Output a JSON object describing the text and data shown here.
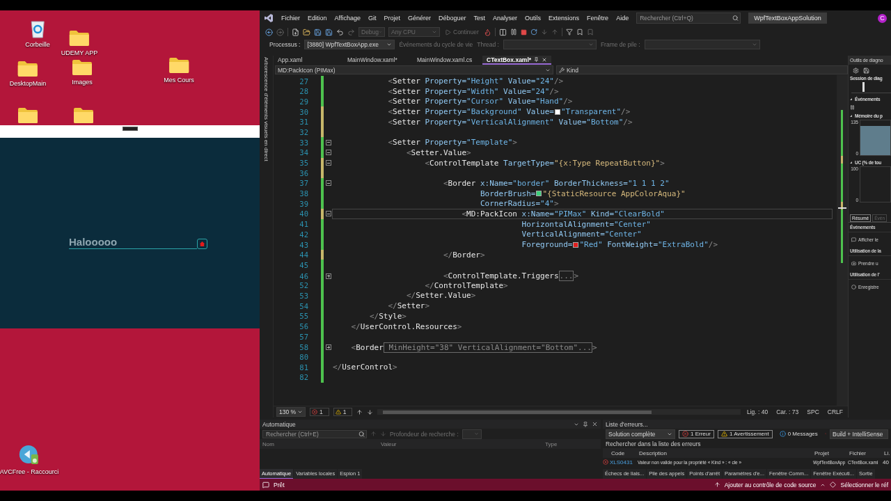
{
  "desktop": {
    "icons": [
      {
        "kind": "recycle-bin",
        "label": "Corbeille"
      },
      {
        "kind": "folder",
        "label": "UDEMY APP"
      },
      {
        "kind": "folder",
        "label": "DesktopMain"
      },
      {
        "kind": "folder",
        "label": "Images"
      },
      {
        "kind": "folder",
        "label": "Mes Cours"
      },
      {
        "kind": "folder"
      },
      {
        "kind": "folder"
      },
      {
        "kind": "app",
        "label": "AVCFree - Raccourci"
      }
    ],
    "preview_window": {
      "text_field": {
        "value": "Halooooo"
      }
    }
  },
  "ide": {
    "menu": [
      "Fichier",
      "Edition",
      "Affichage",
      "Git",
      "Projet",
      "Générer",
      "Déboguer",
      "Test",
      "Analyser",
      "Outils",
      "Extensions",
      "Fenêtre",
      "Aide"
    ],
    "search": {
      "placeholder": "Rechercher (Ctrl+Q)"
    },
    "solution": "WpfTextBoxAppSolution",
    "avatar": "C",
    "toolbar": {
      "configuration": {
        "value": "Debug",
        "disabled": true
      },
      "platform": {
        "value": "Any CPU",
        "disabled": true
      },
      "continue": {
        "label": "Continuer",
        "disabled": true
      }
    },
    "process_bar": {
      "process_label": "Processus :",
      "process": "[3880] WpfTextBoxApp.exe",
      "lifecycle": "Événements du cycle de vie",
      "thread_label": "Thread :",
      "frame_label": "Frame de pile :"
    },
    "side_strip": "Arborescence d'éléments visuels en direct",
    "tabs": [
      {
        "label": "App.xaml",
        "selected": false
      },
      {
        "label": "MainWindow.xaml*",
        "selected": false
      },
      {
        "label": "MainWindow.xaml.cs",
        "selected": false
      },
      {
        "label": "CTextBox.xaml*",
        "selected": true
      }
    ],
    "nav": {
      "element": "MD:PackIcon (PIMax)",
      "member": "Kind"
    },
    "code": [
      {
        "number": "27",
        "modified": false,
        "current": false,
        "segments": [
          {
            "kind": "code",
            "text": "            <Setter Property=\"Height\" Value=\"24\"/>"
          }
        ]
      },
      {
        "number": "28",
        "modified": false,
        "current": false,
        "segments": [
          {
            "kind": "code",
            "text": "            <Setter Property=\"Width\" Value=\"24\"/>"
          }
        ]
      },
      {
        "number": "29",
        "modified": false,
        "current": false,
        "segments": [
          {
            "kind": "code",
            "text": "            <Setter Property=\"Cursor\" Value=\"Hand\"/>"
          }
        ]
      },
      {
        "number": "30",
        "modified": true,
        "current": false,
        "segments": [
          {
            "kind": "code",
            "text": "            <Setter Property=\"Background\" Value="
          },
          {
            "kind": "swatch",
            "color": "#ffffff"
          },
          {
            "kind": "code",
            "text": "\"Transparent\"/>"
          }
        ]
      },
      {
        "number": "31",
        "modified": true,
        "current": false,
        "segments": [
          {
            "kind": "code",
            "text": "            <Setter Property=\"VerticalAlignment\" Value=\"Bottom\"/>"
          }
        ]
      },
      {
        "number": "32",
        "modified": true,
        "current": false
      },
      {
        "number": "33",
        "modified": false,
        "expanded": true,
        "current": false,
        "segments": [
          {
            "kind": "code",
            "text": "            <Setter Property=\"Template\">"
          }
        ]
      },
      {
        "number": "34",
        "modified": false,
        "expanded": true,
        "current": false,
        "segments": [
          {
            "kind": "code",
            "text": "                <Setter.Value>"
          }
        ]
      },
      {
        "number": "35",
        "modified": true,
        "expanded": true,
        "current": false,
        "segments": [
          {
            "kind": "code",
            "text": "                    <ControlTemplate TargetType=\"{x:Type RepeatButton}\">"
          }
        ]
      },
      {
        "number": "36",
        "modified": true,
        "current": false
      },
      {
        "number": "37",
        "modified": false,
        "expanded": true,
        "current": false,
        "segments": [
          {
            "kind": "code",
            "text": "                        <Border x:Name=\"border\" BorderThickness=\"1 1 1 2\""
          }
        ]
      },
      {
        "number": "38",
        "modified": false,
        "current": false,
        "segments": [
          {
            "kind": "code",
            "text": "                                BorderBrush="
          },
          {
            "kind": "swatch",
            "color": "#3ccf7a"
          },
          {
            "kind": "code",
            "text": "\"{StaticResource AppColorAqua}\""
          }
        ]
      },
      {
        "number": "39",
        "modified": false,
        "current": false,
        "segments": [
          {
            "kind": "code",
            "text": "                                CornerRadius=\"4\">"
          }
        ]
      },
      {
        "number": "40",
        "modified": true,
        "expanded": true,
        "current": true,
        "segments": [
          {
            "kind": "code",
            "text": "                            <MD:PackIcon x:Name=\"PIMax\" Kind=\"ClearBold\""
          }
        ]
      },
      {
        "number": "41",
        "modified": false,
        "current": false,
        "segments": [
          {
            "kind": "code",
            "text": "                                         HorizontalAlignment=\"Center\""
          }
        ]
      },
      {
        "number": "42",
        "modified": false,
        "current": false,
        "segments": [
          {
            "kind": "code",
            "text": "                                         VerticalAlignment=\"Center\""
          }
        ]
      },
      {
        "number": "43",
        "modified": false,
        "current": false,
        "segments": [
          {
            "kind": "code",
            "text": "                                         Foreground="
          },
          {
            "kind": "swatch",
            "color": "#e02020"
          },
          {
            "kind": "code",
            "text": "\"Red\" FontWeight=\"ExtraBold\"/>"
          }
        ]
      },
      {
        "number": "44",
        "modified": true,
        "current": false,
        "segments": [
          {
            "kind": "code",
            "text": "                        </Border>"
          }
        ]
      },
      {
        "number": "45",
        "modified": false,
        "current": false
      },
      {
        "number": "46",
        "modified": false,
        "expanded": false,
        "current": false,
        "segments": [
          {
            "kind": "code",
            "text": "                        <ControlTemplate.Triggers"
          },
          {
            "kind": "collapsed",
            "text": "..."
          },
          {
            "kind": "code",
            "text": ">"
          }
        ]
      },
      {
        "number": "52",
        "modified": false,
        "current": false,
        "segments": [
          {
            "kind": "code",
            "text": "                    </ControlTemplate>"
          }
        ]
      },
      {
        "number": "53",
        "modified": false,
        "current": false,
        "segments": [
          {
            "kind": "code",
            "text": "                </Setter.Value>"
          }
        ]
      },
      {
        "number": "54",
        "modified": false,
        "current": false,
        "segments": [
          {
            "kind": "code",
            "text": "            </Setter>"
          }
        ]
      },
      {
        "number": "55",
        "modified": false,
        "current": false,
        "segments": [
          {
            "kind": "code",
            "text": "        </Style>"
          }
        ]
      },
      {
        "number": "56",
        "modified": false,
        "current": false,
        "segments": [
          {
            "kind": "code",
            "text": "    </UserControl.Resources>"
          }
        ]
      },
      {
        "number": "57",
        "modified": false,
        "current": false
      },
      {
        "number": "58",
        "modified": false,
        "expanded": false,
        "current": false,
        "segments": [
          {
            "kind": "code",
            "text": "    <Border"
          },
          {
            "kind": "collapsed",
            "text": " MinHeight=\"38\" VerticalAlignment=\"Bottom\"..."
          },
          {
            "kind": "code",
            "text": ">"
          }
        ]
      },
      {
        "number": "80",
        "modified": false,
        "current": false
      },
      {
        "number": "81",
        "modified": false,
        "current": false,
        "segments": [
          {
            "kind": "code",
            "text": "</UserControl>"
          }
        ]
      },
      {
        "number": "82",
        "modified": false,
        "current": false
      }
    ],
    "editor_status": {
      "zoom": "130 %",
      "errors": "1",
      "warnings": "1",
      "line": "Lig. : 40",
      "column": "Car. : 73",
      "whitespace": "SPC",
      "line_ending": "CRLF"
    },
    "auto_panel": {
      "title": "Automatique",
      "search": {
        "placeholder": "Rechercher (Ctrl+E)"
      },
      "depth_label": "Profondeur de recherche :",
      "columns": [
        "Nom",
        "Valeur",
        "Type"
      ],
      "tabs": [
        {
          "label": "Automatique",
          "selected": true
        },
        {
          "label": "Variables locales",
          "selected": false
        },
        {
          "label": "Espion 1",
          "selected": false
        }
      ]
    },
    "error_panel": {
      "title": "Liste d'erreurs...",
      "scope": "Solution complète",
      "filters": [
        {
          "kind": "error",
          "label": "1 Erreur",
          "on": true
        },
        {
          "kind": "warning",
          "label": "1 Avertissement",
          "on": true
        },
        {
          "kind": "info",
          "label": "0 Messages",
          "on": false
        }
      ],
      "source": "Build + IntelliSense",
      "search": {
        "placeholder": "Rechercher dans la liste des erreurs"
      },
      "columns": [
        "Code",
        "Description",
        "Projet",
        "Fichier",
        "Li."
      ],
      "rows": [
        {
          "code": "XLS0431",
          "description": "Valeur non valide pour la propriété « Kind » : « cle »",
          "project": "WpfTextBoxApp",
          "file": "CTextBox.xaml",
          "line": "40"
        }
      ],
      "tabs": [
        {
          "label": "Échecs de liais...",
          "selected": false
        },
        {
          "label": "Pile des appels",
          "selected": false
        },
        {
          "label": "Points d'arrêt",
          "selected": false
        },
        {
          "label": "Paramètres d'e...",
          "selected": false
        },
        {
          "label": "Fenêtre Comm...",
          "selected": false
        },
        {
          "label": "Fenêtre Exécuti...",
          "selected": false
        },
        {
          "label": "Sortie",
          "selected": false
        }
      ]
    },
    "diagnostics": {
      "title": "Outils de diagno",
      "session": "Session de diag",
      "events_label": "Événements",
      "memory_label": "Mémoire du p",
      "memory_ticks": [
        "135",
        "0"
      ],
      "cpu_label": "UC (% de tou",
      "cpu_ticks": [
        "100",
        "0"
      ],
      "tabs": [
        {
          "label": "Résumé",
          "selected": true
        },
        {
          "label": "Évén",
          "selected": false
        }
      ],
      "summary": [
        {
          "heading": "Événements",
          "action": "Afficher le"
        },
        {
          "heading": "Utilisation de la",
          "action": "Prendre u"
        },
        {
          "heading": "Utilisation de l'",
          "action": "Enregistre"
        }
      ]
    },
    "status_bar": {
      "text": "Prêt",
      "source_control": "Ajouter au contrôle de code source",
      "repo": "Sélectionner le réf"
    }
  }
}
